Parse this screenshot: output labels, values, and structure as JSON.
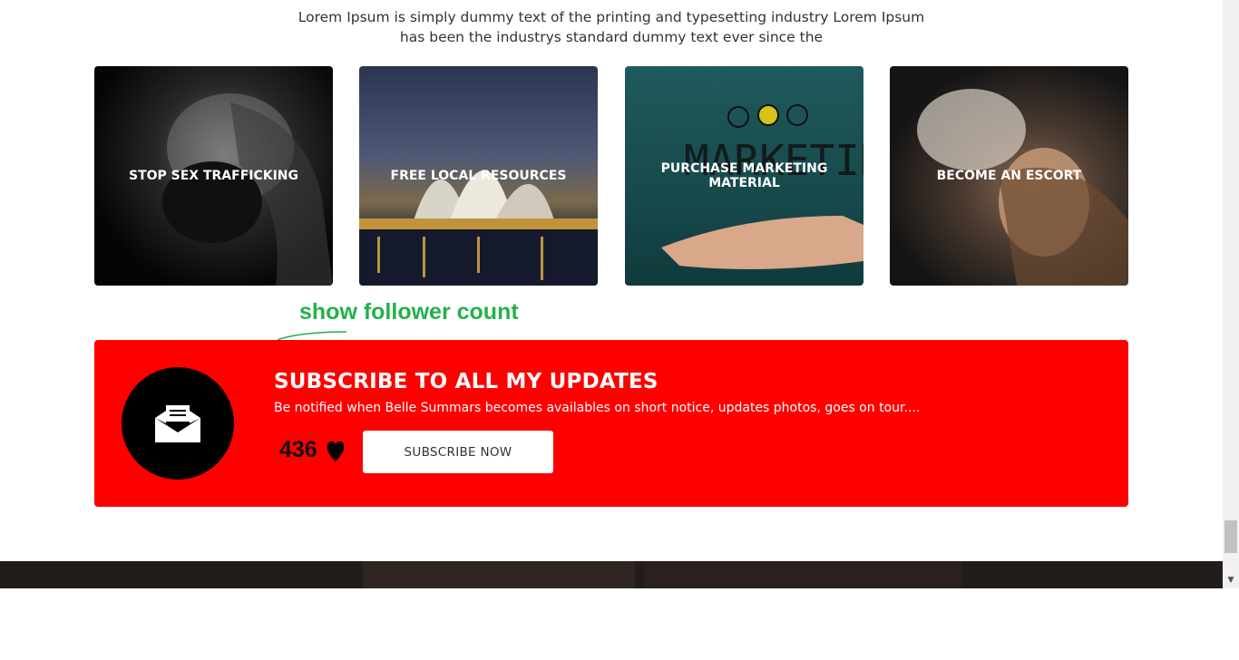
{
  "intro": {
    "line1": "Lorem Ipsum is simply dummy text of the printing and typesetting industry Lorem Ipsum",
    "line2": "has been the industrys standard dummy text ever since the"
  },
  "cards": [
    {
      "label": "STOP SEX TRAFFICKING"
    },
    {
      "label": "FREE LOCAL RESOURCES"
    },
    {
      "label": "PURCHASE MARKETING MATERIAL",
      "image_text": "MARKETING"
    },
    {
      "label": "BECOME AN ESCORT"
    }
  ],
  "annotation": {
    "text": "show follower count",
    "color": "#22b14c"
  },
  "subscribe": {
    "title": "SUBSCRIBE TO ALL MY UPDATES",
    "subtitle": "Be notified when Belle Summars becomes availables on short notice, updates photos, goes on tour....",
    "follower_count": "436",
    "button_label": "SUBSCRIBE NOW",
    "icon": "envelope-icon",
    "background": "#ff0000"
  }
}
